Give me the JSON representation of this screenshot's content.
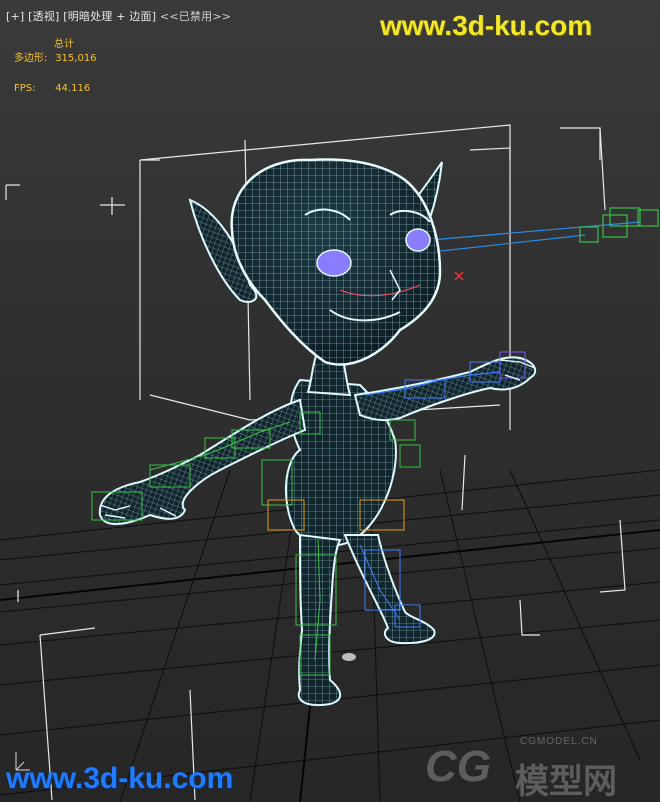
{
  "viewport": {
    "menu": {
      "plus": "[+]",
      "view": "[透视]",
      "shading": "[明暗处理 + 边面]",
      "disabled": "<<已禁用>>"
    },
    "stats": {
      "total_label": "总计",
      "polygons_label": "多边形:",
      "polygons_value": "315,016",
      "fps_label": "FPS:",
      "fps_value": "44.116"
    }
  },
  "watermarks": {
    "top": "www.3d-ku.com",
    "bottom": "www.3d-ku.com",
    "logo_big": "CG",
    "logo_text": "模型网",
    "logo_small": "CGMODEL.CN"
  },
  "colors": {
    "stats_text": "#f2c12e",
    "mesh_cyan": "#9fe8ff",
    "bone_blue": "#3d7dff",
    "bone_green": "#38c048",
    "bone_orange": "#e59a1e",
    "watermark_yellow": "#f2e829",
    "watermark_blue": "#1f7bff"
  },
  "icons": [
    "axis-gizmo-icon",
    "cg-model-logo"
  ]
}
